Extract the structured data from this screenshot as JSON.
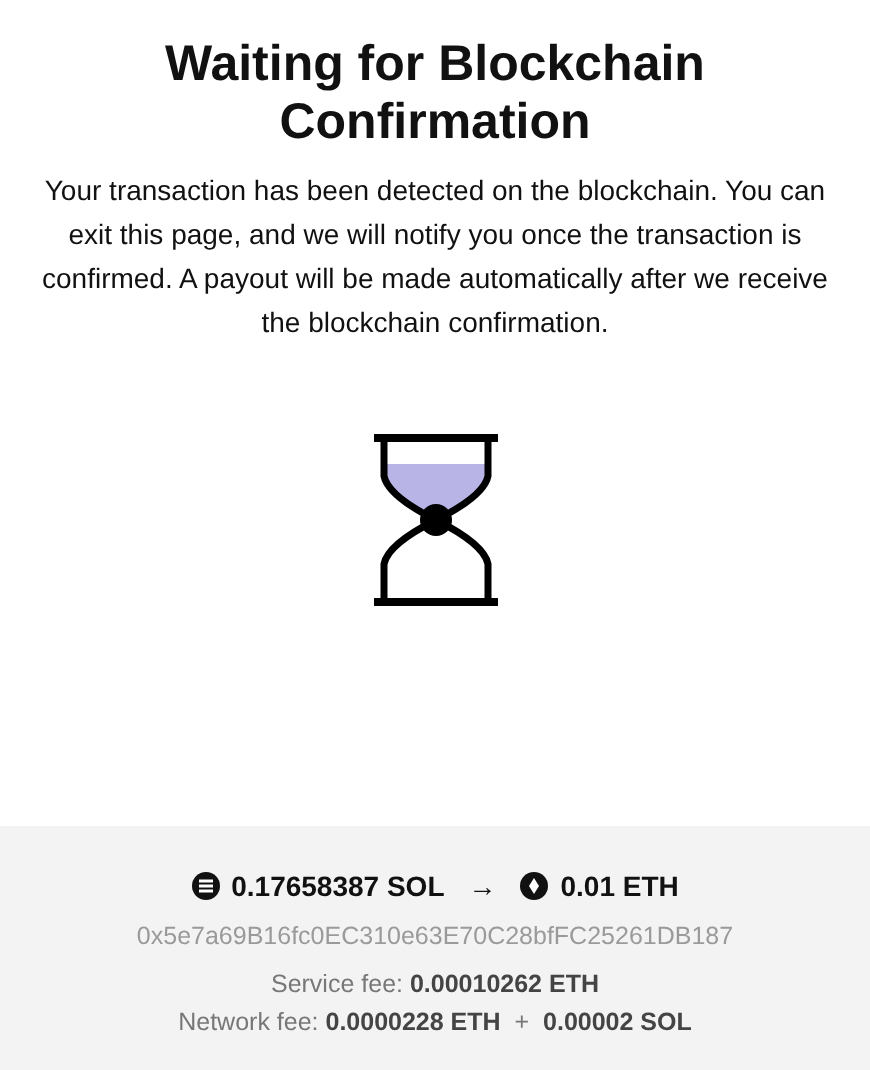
{
  "title": "Waiting for Blockchain Confirmation",
  "message": "Your transaction has been detected on the blockchain. You can exit this page, and we will notify you once the transaction is confirmed. A payout will be made automatically after we receive the blockchain confirmation.",
  "exchange": {
    "from_amount": "0.17658387 SOL",
    "arrow": "→",
    "to_amount": "0.01 ETH"
  },
  "address": "0x5e7a69B16fc0EC310e63E70C28bfFC25261DB187",
  "fees": [
    "Service fee: **0.00010262 ETH**",
    "Network fee: **0.0000228 ETH**  +  **0.00002 SOL**"
  ]
}
